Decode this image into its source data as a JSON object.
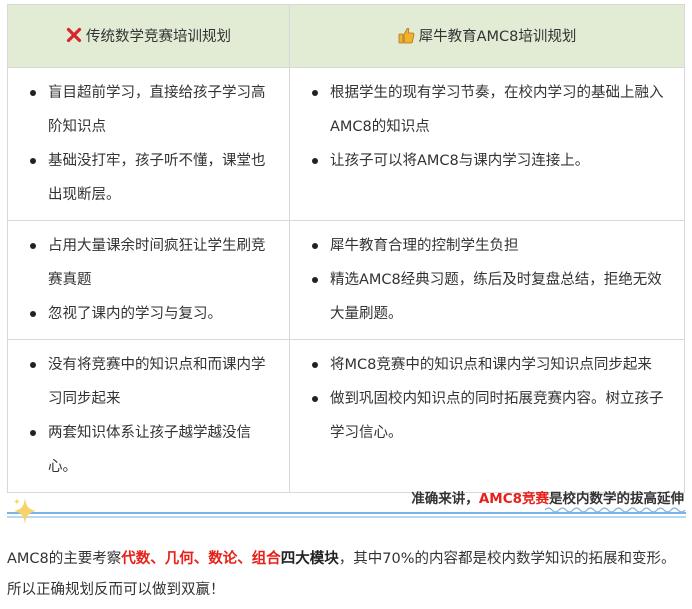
{
  "table": {
    "header_left": "传统数学竞赛培训规划",
    "header_right": "犀牛教育AMC8培训规划",
    "rows": [
      {
        "left": [
          "盲目超前学习，直接给孩子学习高阶知识点",
          "基础没打牢，孩子听不懂，课堂也出现断层。"
        ],
        "right": [
          "根据学生的现有学习节奏，在校内学习的基础上融入AMC8的知识点",
          "让孩子可以将AMC8与课内学习连接上。"
        ]
      },
      {
        "left": [
          "占用大量课余时间疯狂让学生刷竞赛真题",
          "忽视了课内的学习与复习。"
        ],
        "right": [
          "犀牛教育合理的控制学生负担",
          "精选AMC8经典习题，练后及时复盘总结，拒绝无效大量刷题。"
        ]
      },
      {
        "left": [
          "没有将竞赛中的知识点和而课内学习同步起来",
          "两套知识体系让孩子越学越没信心。"
        ],
        "right": [
          "将MC8竞赛中的知识点和课内学习知识点同步起来",
          "做到巩固校内知识点的同时拓展竞赛内容。树立孩子学习信心。"
        ]
      }
    ]
  },
  "tagline": {
    "prefix": "准确来讲，",
    "highlight": "AMC8竞赛",
    "suffix": "是校内数学的拔高延伸"
  },
  "paragraph": {
    "part1": "AMC8的主要考察",
    "red": "代数、几何、数论、组合",
    "bold": "四大模块",
    "part2": "，其中70%的内容都是校内数学知识的拓展和变形。所以正确规划反而可以做到双赢！"
  },
  "colors": {
    "header_bg": "#e2ecd5",
    "accent_red": "#e8201a",
    "divider_blue": "#7db4e6"
  },
  "icons": {
    "header_left": "cross-mark-icon",
    "header_right": "thumbs-up-icon",
    "divider": "sparkle-icon"
  }
}
